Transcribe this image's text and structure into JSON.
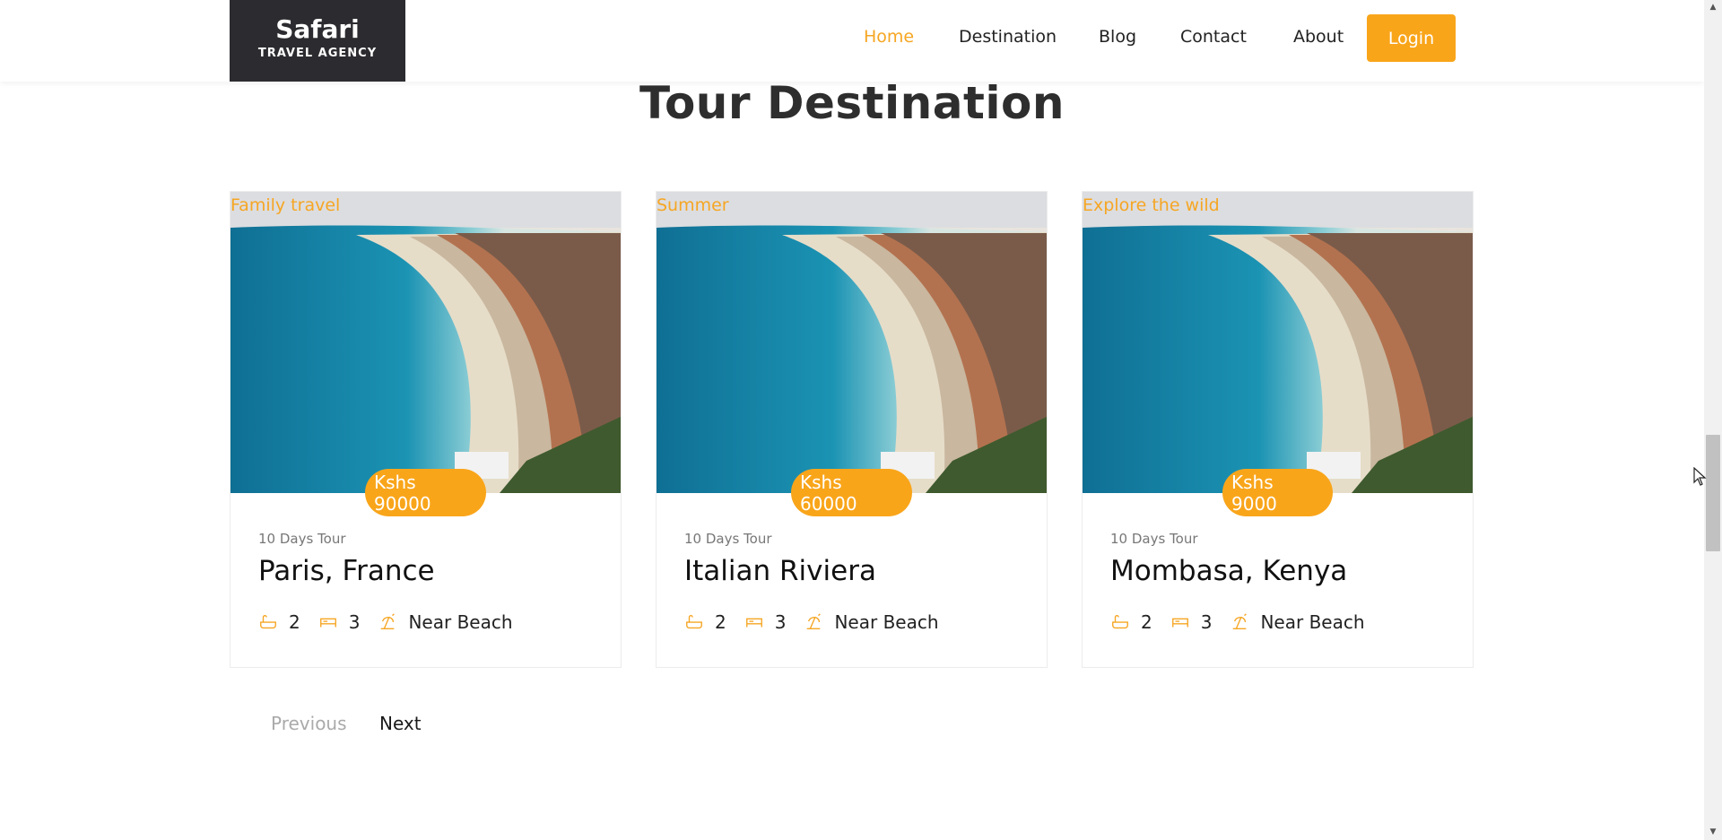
{
  "header": {
    "logo": {
      "brand": "Safari",
      "tagline": "TRAVEL AGENCY"
    },
    "nav": [
      {
        "label": "Home",
        "active": true
      },
      {
        "label": "Destination",
        "active": false
      },
      {
        "label": "Blog",
        "active": false
      },
      {
        "label": "Contact",
        "active": false
      },
      {
        "label": "About",
        "active": false
      }
    ],
    "login_label": "Login"
  },
  "section": {
    "title": "Tour Destination"
  },
  "cards": [
    {
      "category": "Family travel",
      "price": "Kshs 90000",
      "duration": "10 Days Tour",
      "name": "Paris, France",
      "baths": "2",
      "beds": "3",
      "location": "Near Beach"
    },
    {
      "category": "Summer",
      "price": "Kshs 60000",
      "duration": "10 Days Tour",
      "name": "Italian Riviera",
      "baths": "2",
      "beds": "3",
      "location": "Near Beach"
    },
    {
      "category": "Explore the wild",
      "price": "Kshs 9000",
      "duration": "10 Days Tour",
      "name": "Mombasa, Kenya",
      "baths": "2",
      "beds": "3",
      "location": "Near Beach"
    }
  ],
  "pagination": {
    "previous": "Previous",
    "next": "Next"
  },
  "colors": {
    "accent": "#f9a51a",
    "logo_bg": "#2c2c30",
    "active_nav": "#f6a623"
  },
  "icons": [
    "bathtub-icon",
    "bed-icon",
    "beach-icon"
  ]
}
